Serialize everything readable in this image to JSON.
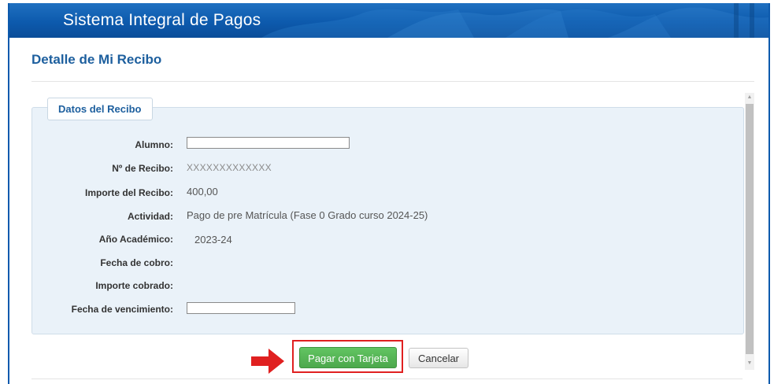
{
  "header": {
    "app_title": "Sistema Integral de Pagos",
    "background_color": "#0d5aad"
  },
  "page": {
    "title": "Detalle de Mi Recibo"
  },
  "receipt_panel": {
    "legend": "Datos del Recibo",
    "fields": [
      {
        "label": "Alumno:",
        "value": ""
      },
      {
        "label": "Nº de Recibo:",
        "value": "XXXXXXXXXXXXX"
      },
      {
        "label": "Importe del Recibo:",
        "value": "400,00"
      },
      {
        "label": "Actividad:",
        "value": "Pago de pre Matrícula (Fase 0 Grado curso 2024-25)"
      },
      {
        "label": "Año Académico:",
        "value": "2023-24"
      },
      {
        "label": "Fecha de cobro:",
        "value": ""
      },
      {
        "label": "Importe cobrado:",
        "value": ""
      },
      {
        "label": "Fecha de vencimiento:",
        "value": ""
      }
    ]
  },
  "actions": {
    "pay_label": "Pagar con Tarjeta",
    "cancel_label": "Cancelar",
    "pay_color": "#5cb85c",
    "highlight_color": "#e02020",
    "arrow_icon": "red-right-arrow-icon"
  }
}
